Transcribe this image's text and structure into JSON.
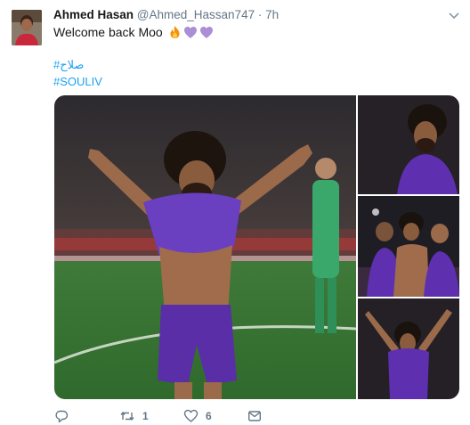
{
  "tweet": {
    "author_name": "Ahmed Hasan",
    "author_handle": "@Ahmed_Hassan747",
    "separator": "·",
    "time": "7h",
    "text": "Welcome back Moo",
    "emojis": [
      "fire-emoji",
      "purple-heart-emoji",
      "purple-heart-emoji"
    ],
    "hashtags": [
      "#صلاح",
      "#SOULIV"
    ]
  },
  "media": {
    "images": [
      "celebration-main-photo",
      "portrait-photo",
      "team-celebration-photo",
      "arms-raised-photo"
    ]
  },
  "actions": {
    "reply_count": "",
    "retweet_count": "1",
    "like_count": "6"
  },
  "colors": {
    "link": "#1da1f2",
    "secondary_text": "#657786",
    "kit_purple": "#5a2ea6"
  },
  "icons": [
    "chevron-down-icon",
    "reply-icon",
    "retweet-icon",
    "like-icon",
    "dm-icon"
  ]
}
